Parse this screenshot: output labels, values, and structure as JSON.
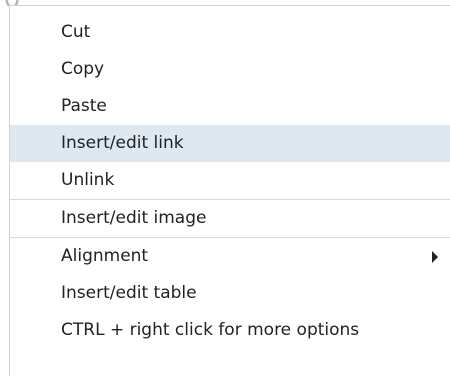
{
  "menu": {
    "items": [
      {
        "label": "Cut"
      },
      {
        "label": "Copy"
      },
      {
        "label": "Paste"
      },
      {
        "label": "Insert/edit link"
      },
      {
        "label": "Unlink"
      },
      {
        "label": "Insert/edit image"
      },
      {
        "label": "Alignment",
        "icon": "submenu-arrow-icon"
      },
      {
        "label": "Insert/edit table"
      },
      {
        "label": "CTRL + right click for more options"
      }
    ],
    "highlighted_item": "Insert/edit link",
    "colors": {
      "highlight": "#dde8f0",
      "text": "#222222",
      "separator": "#d9d9d9"
    }
  }
}
